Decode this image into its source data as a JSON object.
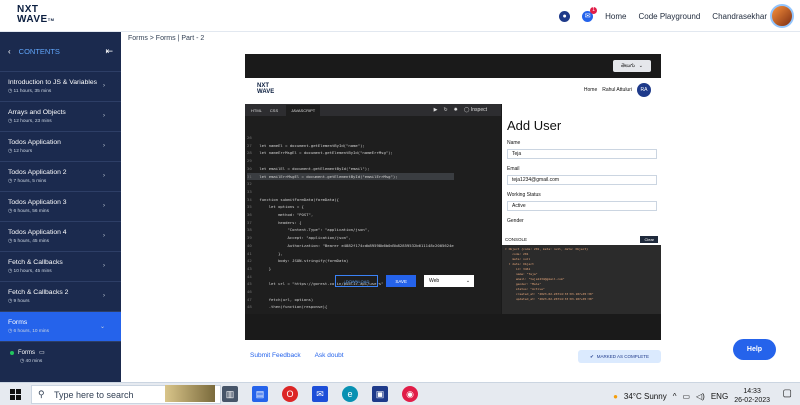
{
  "topbar": {
    "logo_line1": "NXT",
    "logo_line2": "WAVE",
    "logo_tm": "TM",
    "notification_count": "1",
    "home": "Home",
    "playground": "Code Playground",
    "user": "Chandrasekhar"
  },
  "sidebar": {
    "header": "CONTENTS",
    "items": [
      {
        "title": "Introduction to JS & Variables",
        "duration": "11 hours, 35 mins"
      },
      {
        "title": "Arrays and Objects",
        "duration": "12 hours, 23 mins"
      },
      {
        "title": "Todos Application",
        "duration": "12 hours"
      },
      {
        "title": "Todos Application 2",
        "duration": "7 hours, 5 mins"
      },
      {
        "title": "Todos Application 3",
        "duration": "6 hours, 56 mins"
      },
      {
        "title": "Todos Application 4",
        "duration": "5 hours, 45 mins"
      },
      {
        "title": "Fetch & Callbacks",
        "duration": "10 hours, 45 mins"
      },
      {
        "title": "Fetch & Callbacks 2",
        "duration": "9 hours"
      },
      {
        "title": "Forms",
        "duration": "6 hours, 10 mins"
      }
    ],
    "sub_item": {
      "title": "Forms",
      "duration": "40 mins"
    }
  },
  "breadcrumb": "Forms > Forms | Part - 2",
  "video": {
    "language": "తెలుగు",
    "app_home": "Home",
    "app_user": "Rahul Attuluri",
    "app_initials": "RA",
    "tabs": [
      "HTML",
      "CSS",
      "JAVASCRIPT"
    ],
    "inspect": "Inspect",
    "code_lines": [
      {
        "n": "26",
        "t": ""
      },
      {
        "n": "27",
        "t": "let nameEl = document.getElementById(\"name\");"
      },
      {
        "n": "28",
        "t": "let nameErrMsgEl = document.getElementById(\"nameErrMsg\");"
      },
      {
        "n": "29",
        "t": ""
      },
      {
        "n": "30",
        "t": "let emailEl = document.getElementById(\"email\");"
      },
      {
        "n": "31",
        "t": "let emailErrMsgEl = document.getElementById(\"emailErrMsg\");"
      },
      {
        "n": "32",
        "t": ""
      },
      {
        "n": "33",
        "t": ""
      },
      {
        "n": "34",
        "t": "function submitFormData(formData){"
      },
      {
        "n": "35",
        "t": "    let options = {"
      },
      {
        "n": "36",
        "t": "        method: \"POST\","
      },
      {
        "n": "37",
        "t": "        headers: {"
      },
      {
        "n": "38",
        "t": "            \"Content-Type\": \"application/json\","
      },
      {
        "n": "39",
        "t": "            Accept: \"application/json\","
      },
      {
        "n": "40",
        "t": "            Authorization: \"Bearer e4882f174cdb89598b6b0d5b82859532b611148c2005624e"
      },
      {
        "n": "41",
        "t": "        },"
      },
      {
        "n": "42",
        "t": "        body: JSON.stringify(formData)"
      },
      {
        "n": "43",
        "t": "    }"
      },
      {
        "n": "44",
        "t": ""
      },
      {
        "n": "45",
        "t": "    let url = \"https://gorest.co.in/public-api/users\""
      },
      {
        "n": "46",
        "t": ""
      },
      {
        "n": "47",
        "t": "    fetch(url, options)"
      },
      {
        "n": "48",
        "t": "    .then(function(response){"
      }
    ],
    "download": "DOWNLOAD",
    "save": "SAVE",
    "env_select": "Web",
    "preview": {
      "title": "Add User",
      "name_label": "Name",
      "name_value": "Teja",
      "email_label": "Email",
      "email_value": "teja1234@gmail.com",
      "status_label": "Working Status",
      "status_value": "Active",
      "gender_label": "Gender"
    },
    "console_label": "CONSOLE",
    "clear": "Clear",
    "console_lines": [
      "▾ Object {code: 201, meta: null, data: Object}",
      "    code: 201",
      "    meta: null",
      "  ▾ data: Object",
      "      id: 3461",
      "      name: \"Teja\"",
      "      email: \"teja1234@gmail.com\"",
      "      gender: \"Male\"",
      "      status: \"Active\"",
      "      created_at: \"2023-02-26T14:33:03.187+05:30\"",
      "      updated_at: \"2023-02-26T14:33:03.187+05:30\""
    ]
  },
  "footer_links": [
    "Submit Feedback",
    "Ask doubt"
  ],
  "complete_button": "MARKED AS COMPLETE",
  "help": "Help",
  "taskbar": {
    "search_placeholder": "Type here to search",
    "weather": "34°C  Sunny",
    "lang": "ENG",
    "time": "14:33",
    "date": "26-02-2023"
  }
}
